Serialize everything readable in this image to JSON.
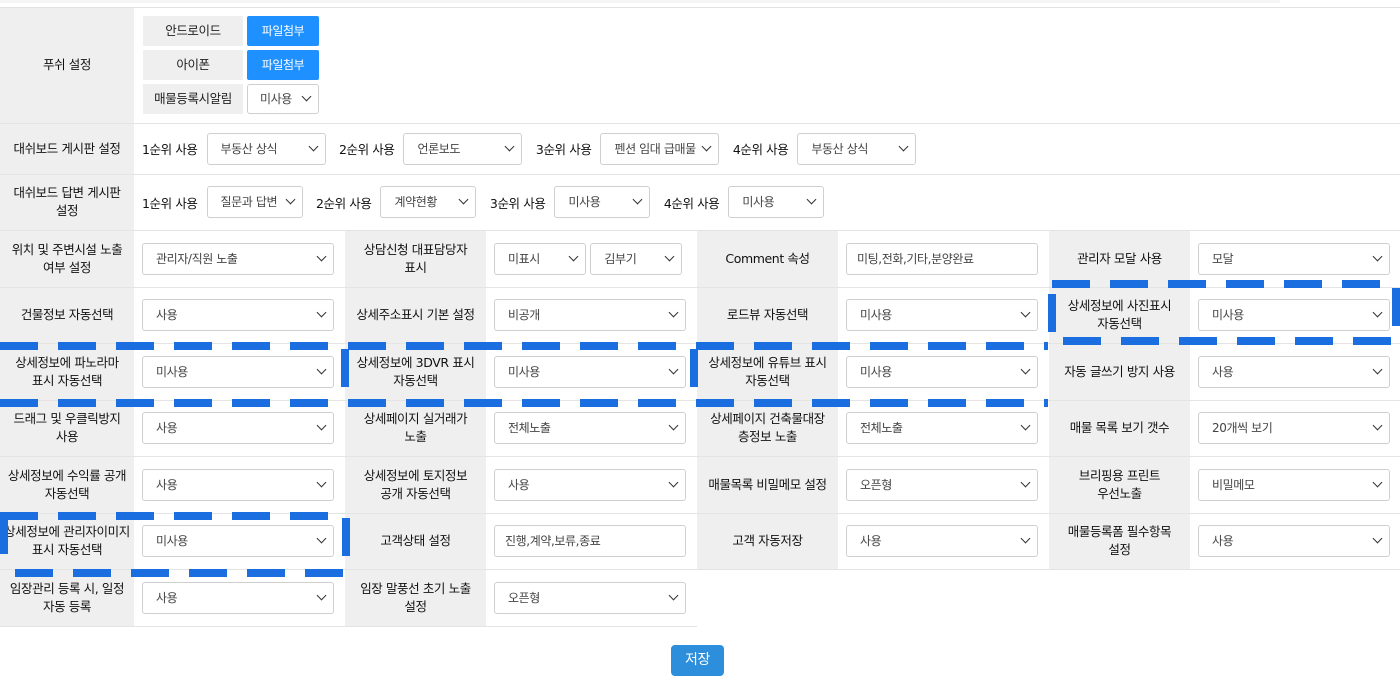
{
  "push": {
    "header": "푸쉬 설정",
    "android_label": "안드로이드",
    "iphone_label": "아이폰",
    "file_button": "파일첨부",
    "alarm_label": "매물등록시알림",
    "alarm_value": "미사용"
  },
  "dash_board": {
    "header": "대쉬보드 게시판 설정",
    "ranks": [
      {
        "label": "1순위 사용",
        "value": "부동산 상식"
      },
      {
        "label": "2순위 사용",
        "value": "언론보도"
      },
      {
        "label": "3순위 사용",
        "value": "펜션 임대 급매물"
      },
      {
        "label": "4순위 사용",
        "value": "부동산 상식"
      }
    ]
  },
  "dash_reply": {
    "header_line1": "대쉬보드 답변 게시판",
    "header_line2": "설정",
    "ranks": [
      {
        "label": "1순위 사용",
        "value": "질문과 답변"
      },
      {
        "label": "2순위 사용",
        "value": "계약현황"
      },
      {
        "label": "3순위 사용",
        "value": "미사용"
      },
      {
        "label": "4순위 사용",
        "value": "미사용"
      }
    ]
  },
  "rows": [
    {
      "c1": {
        "l1": "위치 및 주변시설 노출",
        "l2": "여부 설정",
        "value": "관리자/직원 노출"
      },
      "c2": {
        "l1": "상담신청 대표담당자",
        "l2": "표시",
        "value": "미표시",
        "value2": "김부기"
      },
      "c3": {
        "l1": "Comment 속성",
        "l2": "",
        "input": "미팅,전화,기타,분양완료"
      },
      "c4": {
        "l1": "관리자 모달 사용",
        "l2": "",
        "value": "모달"
      }
    },
    {
      "c1": {
        "l1": "건물정보 자동선택",
        "l2": "",
        "value": "사용"
      },
      "c2": {
        "l1": "상세주소표시 기본 설정",
        "l2": "",
        "value": "비공개"
      },
      "c3": {
        "l1": "로드뷰 자동선택",
        "l2": "",
        "value": "미사용"
      },
      "c4": {
        "l1": "상세정보에 사진표시",
        "l2": "자동선택",
        "value": "미사용"
      }
    },
    {
      "c1": {
        "l1": "상세정보에 파노라마",
        "l2": "표시 자동선택",
        "value": "미사용"
      },
      "c2": {
        "l1": "상세정보에 3DVR 표시",
        "l2": "자동선택",
        "value": "미사용"
      },
      "c3": {
        "l1": "상세정보에 유튜브 표시",
        "l2": "자동선택",
        "value": "미사용"
      },
      "c4": {
        "l1": "자동 글쓰기 방지 사용",
        "l2": "",
        "value": "사용"
      }
    },
    {
      "c1": {
        "l1": "드래그 및 우클릭방지",
        "l2": "사용",
        "value": "사용"
      },
      "c2": {
        "l1": "상세페이지 실거래가",
        "l2": "노출",
        "value": "전체노출"
      },
      "c3": {
        "l1": "상세페이지 건축물대장",
        "l2": "층정보 노출",
        "value": "전체노출"
      },
      "c4": {
        "l1": "매물 목록 보기 갯수",
        "l2": "",
        "value": "20개씩 보기"
      }
    },
    {
      "c1": {
        "l1": "상세정보에 수익률 공개",
        "l2": "자동선택",
        "value": "사용"
      },
      "c2": {
        "l1": "상세정보에 토지정보",
        "l2": "공개 자동선택",
        "value": "사용"
      },
      "c3": {
        "l1": "매물목록 비밀메모 설정",
        "l2": "",
        "value": "오픈형"
      },
      "c4": {
        "l1": "브리핑용 프린트",
        "l2": "우선노출",
        "value": "비밀메모"
      }
    },
    {
      "c1": {
        "l1": "상세정보에 관리자이미지",
        "l2": "표시 자동선택",
        "value": "미사용"
      },
      "c2": {
        "l1": "고객상태 설정",
        "l2": "",
        "input": "진행,계약,보류,종료"
      },
      "c3": {
        "l1": "고객 자동저장",
        "l2": "",
        "value": "사용"
      },
      "c4": {
        "l1": "매물등록폼 필수항목",
        "l2": "설정",
        "value": "사용"
      }
    },
    {
      "c1": {
        "l1": "임장관리 등록 시, 일정",
        "l2": "자동 등록",
        "value": "사용"
      },
      "c2": {
        "l1": "임장 말풍선 초기 노출",
        "l2": "설정",
        "value": "오픈형"
      }
    }
  ],
  "save_label": "저장",
  "colors": {
    "accent": "#1e90ff",
    "highlight_dash": "#1a6ee0",
    "header_bg": "#efefef"
  }
}
